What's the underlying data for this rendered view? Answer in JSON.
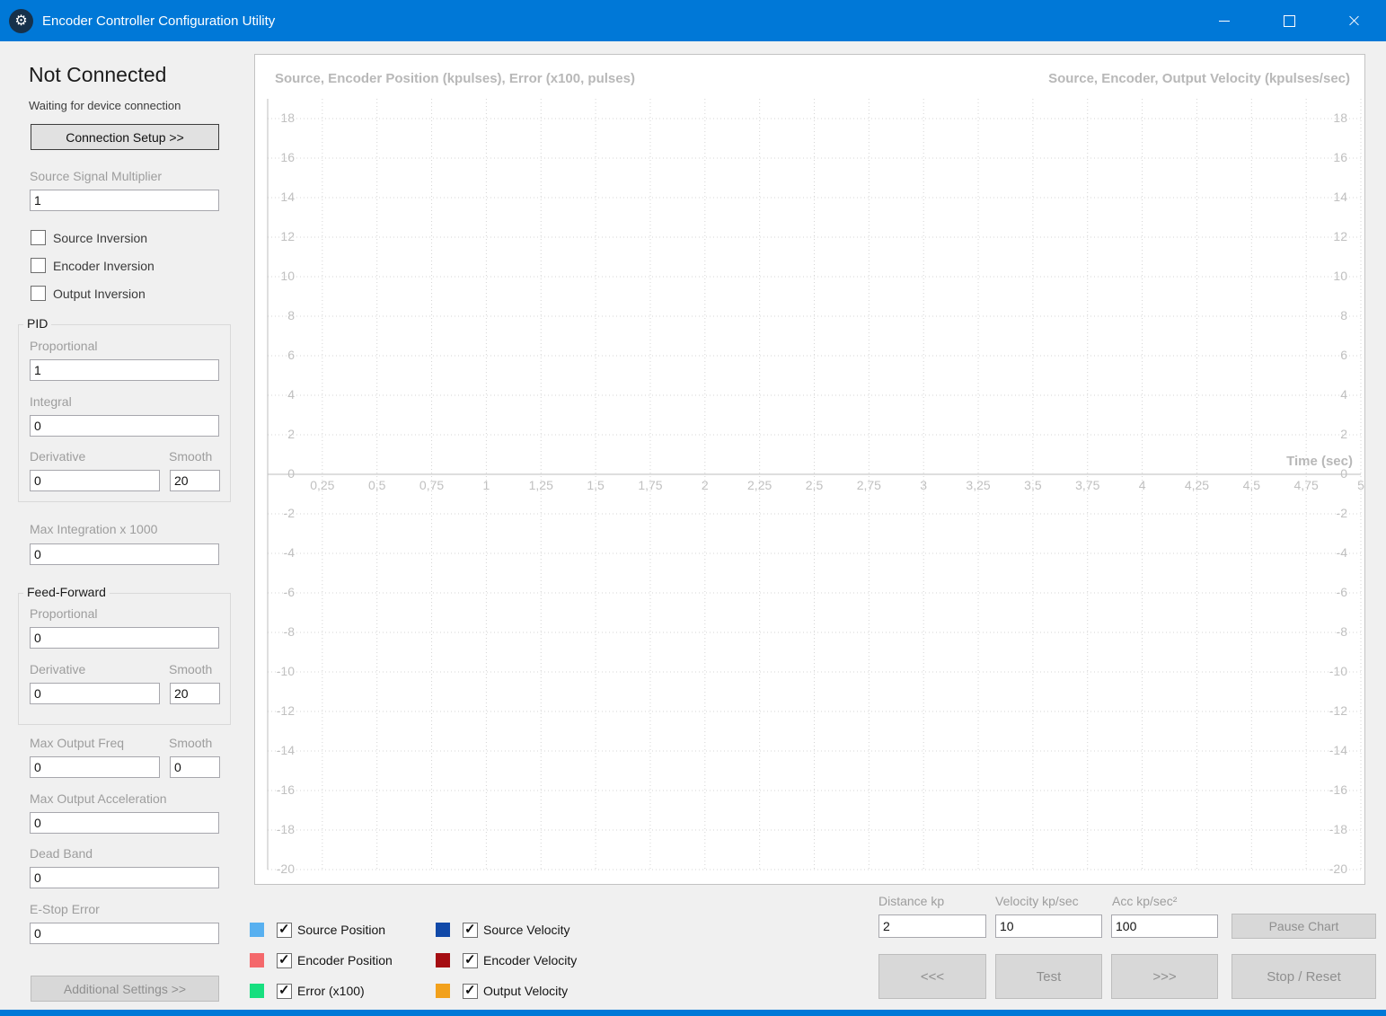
{
  "window": {
    "title": "Encoder Controller Configuration Utility",
    "icon_glyph": "⚙"
  },
  "sidebar": {
    "status_title": "Not Connected",
    "status_subtitle": "Waiting for device connection",
    "connection_setup_label": "Connection Setup >>",
    "source_signal_multiplier": {
      "label": "Source Signal Multiplier",
      "value": "1"
    },
    "inversions": [
      {
        "label": "Source Inversion",
        "checked": false
      },
      {
        "label": "Encoder Inversion",
        "checked": false
      },
      {
        "label": "Output Inversion",
        "checked": false
      }
    ],
    "pid": {
      "title": "PID",
      "proportional": {
        "label": "Proportional",
        "value": "1"
      },
      "integral": {
        "label": "Integral",
        "value": "0"
      },
      "derivative": {
        "label": "Derivative",
        "value": "0"
      },
      "smooth": {
        "label": "Smooth",
        "value": "20"
      }
    },
    "max_integration": {
      "label": "Max Integration x 1000",
      "value": "0"
    },
    "feed_forward": {
      "title": "Feed-Forward",
      "proportional": {
        "label": "Proportional",
        "value": "0"
      },
      "derivative": {
        "label": "Derivative",
        "value": "0"
      },
      "smooth": {
        "label": "Smooth",
        "value": "20"
      }
    },
    "max_output_freq": {
      "label": "Max Output Freq",
      "value": "0"
    },
    "max_output_freq_smooth": {
      "label": "Smooth",
      "value": "0"
    },
    "max_output_acceleration": {
      "label": "Max Output Acceleration",
      "value": "0"
    },
    "dead_band": {
      "label": "Dead Band",
      "value": "0"
    },
    "estop_error": {
      "label": "E-Stop Error",
      "value": "0"
    },
    "additional_settings_label": "Additional Settings >>"
  },
  "chart_data": {
    "type": "line",
    "title_left": "Source, Encoder Position (kpulses), Error (x100, pulses)",
    "title_right": "Source, Encoder, Output Velocity (kpulses/sec)",
    "xlabel": "Time (sec)",
    "x_range": [
      0,
      5
    ],
    "y_range": [
      -20,
      19
    ],
    "x_ticks": [
      "0,25",
      "0,5",
      "0,75",
      "1",
      "1,25",
      "1,5",
      "1,75",
      "2",
      "2,25",
      "2,5",
      "2,75",
      "3",
      "3,25",
      "3,5",
      "3,75",
      "4",
      "4,25",
      "4,5",
      "4,75",
      "5"
    ],
    "y_ticks": [
      18,
      16,
      14,
      12,
      10,
      8,
      6,
      4,
      2,
      0,
      -2,
      -4,
      -6,
      -8,
      -10,
      -12,
      -14,
      -16,
      -18,
      -20
    ],
    "grid": true,
    "legend_position": "bottom",
    "series": []
  },
  "legend": [
    {
      "label": "Source Position",
      "color": "#58b0f0",
      "checked": true
    },
    {
      "label": "Encoder Position",
      "color": "#f4686b",
      "checked": true
    },
    {
      "label": "Error (x100)",
      "color": "#17df7f",
      "checked": true
    },
    {
      "label": "Source Velocity",
      "color": "#1149a8",
      "checked": true
    },
    {
      "label": "Encoder Velocity",
      "color": "#a50d12",
      "checked": true
    },
    {
      "label": "Output Velocity",
      "color": "#f2a11c",
      "checked": true
    }
  ],
  "motion": {
    "distance": {
      "label": "Distance kp",
      "value": "2"
    },
    "velocity": {
      "label": "Velocity kp/sec",
      "value": "10"
    },
    "acceleration": {
      "label": "Acc  kp/sec²",
      "value": "100"
    },
    "pause_chart_label": "Pause Chart",
    "back_label": "<<<",
    "test_label": "Test",
    "forward_label": ">>>",
    "stop_reset_label": "Stop / Reset"
  },
  "colors": {
    "titlebar": "#0078d7",
    "panel_background": "#f0f0f0",
    "chart_background": "#ffffff"
  }
}
